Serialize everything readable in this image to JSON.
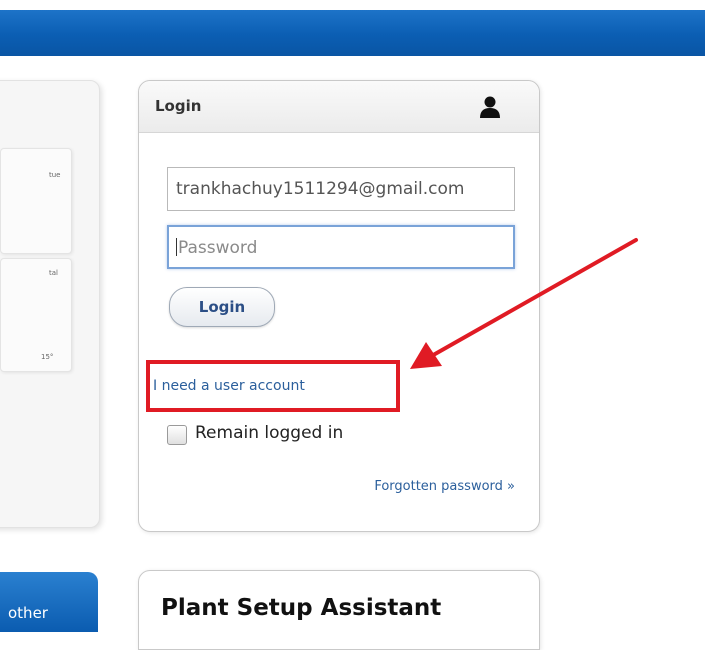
{
  "header": {
    "bar_color": "#0b5eb3"
  },
  "left_panel": {
    "card1_text": "tue",
    "card2_text": "tal",
    "card2_footer": "15°",
    "other_button_label": "other"
  },
  "login": {
    "title": "Login",
    "user_icon": "user-icon",
    "email_value": "trankhachuy1511294@gmail.com",
    "password_placeholder": "Password",
    "login_button_label": "Login",
    "account_link": "I need a user account",
    "remain_logged_in_label": "Remain logged in",
    "forgotten_password_link": "Forgotten password »"
  },
  "plant_setup": {
    "title": "Plant Setup Assistant"
  },
  "annotation": {
    "highlight_color": "#e01b24",
    "arrow_color": "#e01b24"
  }
}
